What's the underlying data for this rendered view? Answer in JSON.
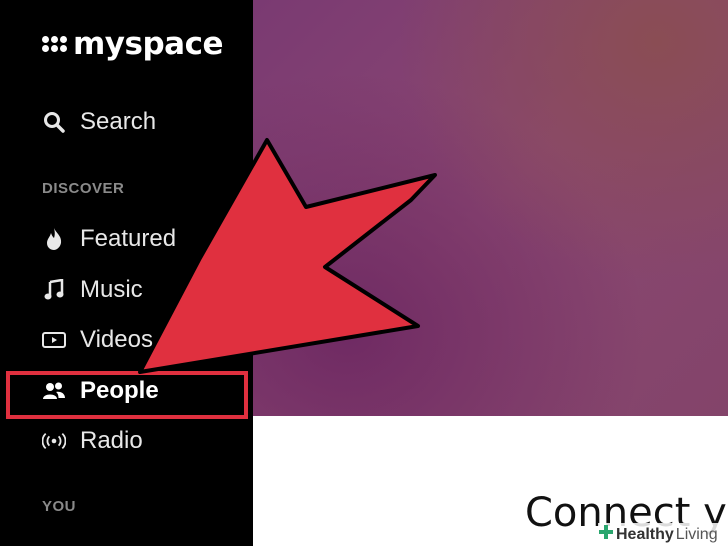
{
  "sidebar": {
    "logo_text": "myspace",
    "search_label": "Search",
    "discover_label": "DISCOVER",
    "items": [
      {
        "label": "Featured",
        "icon": "flame-icon"
      },
      {
        "label": "Music",
        "icon": "music-note-icon"
      },
      {
        "label": "Videos",
        "icon": "video-play-icon"
      },
      {
        "label": "People",
        "icon": "people-icon"
      },
      {
        "label": "Radio",
        "icon": "radio-broadcast-icon"
      }
    ],
    "you_label": "YOU"
  },
  "main": {
    "heading": "Connect yo"
  },
  "annotation": {
    "arrow_color": "#e0303f",
    "highlight_color": "#e0303f"
  },
  "watermark": {
    "brand": "Healthy",
    "suffix": "Living"
  }
}
